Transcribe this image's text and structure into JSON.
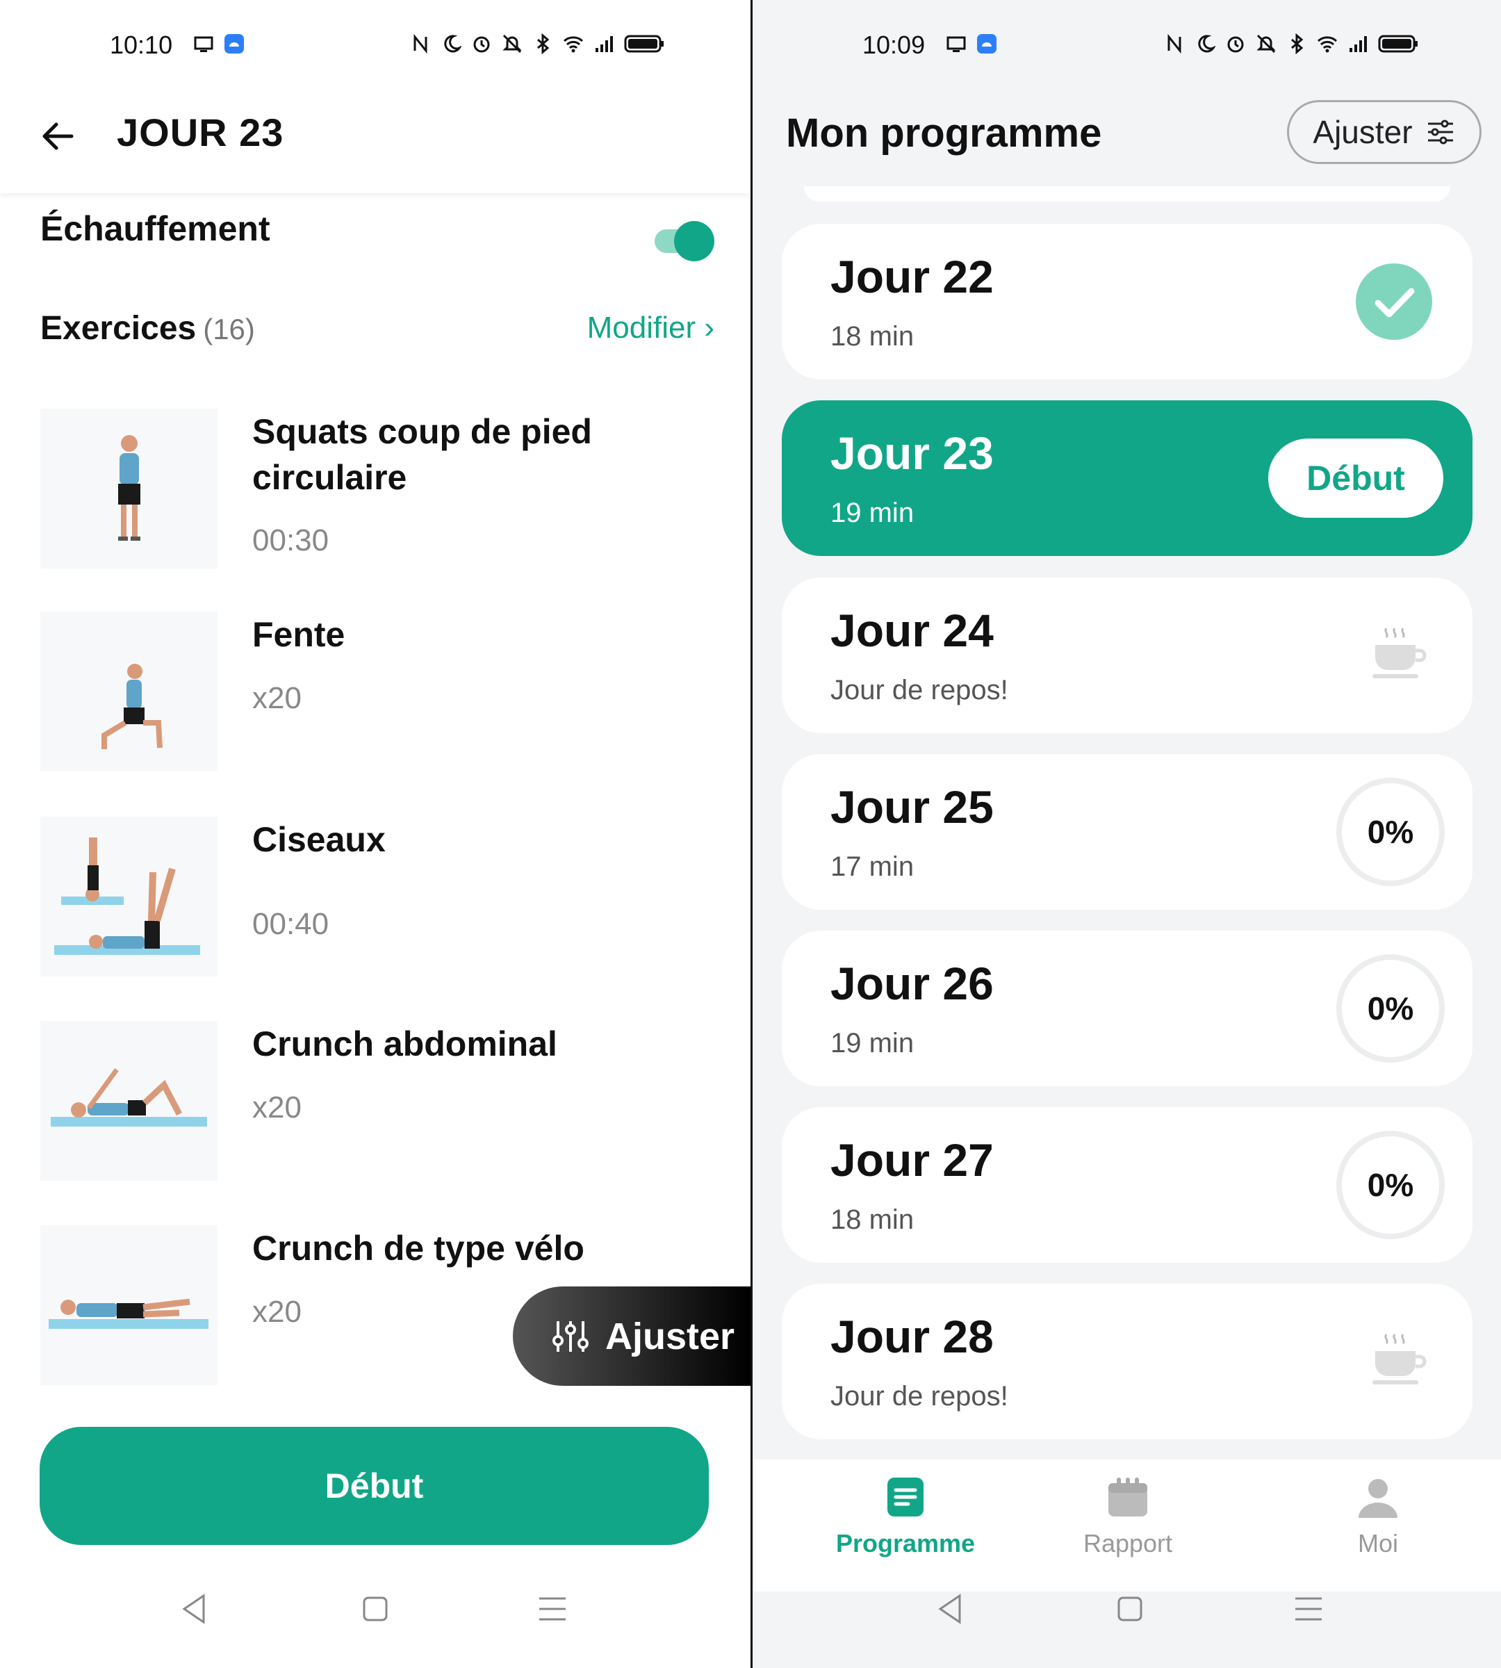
{
  "left": {
    "status": {
      "time": "10:10"
    },
    "title": "JOUR 23",
    "warmup": {
      "label": "Échauffement",
      "enabled": true
    },
    "exercises": {
      "label": "Exercices",
      "count": "(16)",
      "edit": "Modifier",
      "items": [
        {
          "name": "Squats coup de pied circulaire",
          "value": "00:30"
        },
        {
          "name": "Fente",
          "value": "x20"
        },
        {
          "name": "Ciseaux",
          "value": "00:40"
        },
        {
          "name": "Crunch abdominal",
          "value": "x20"
        },
        {
          "name": "Crunch de type vélo",
          "value": "x20"
        }
      ]
    },
    "fab_label": "Ajuster",
    "start_label": "Début"
  },
  "right": {
    "status": {
      "time": "10:09"
    },
    "title": "Mon programme",
    "adjust_label": "Ajuster",
    "days": [
      {
        "name": "Jour 22",
        "sub": "18 min",
        "state": "done"
      },
      {
        "name": "Jour 23",
        "sub": "19 min",
        "state": "current",
        "action": "Début"
      },
      {
        "name": "Jour 24",
        "sub": "Jour de repos!",
        "state": "rest"
      },
      {
        "name": "Jour 25",
        "sub": "17 min",
        "state": "pending",
        "progress": "0%"
      },
      {
        "name": "Jour 26",
        "sub": "19 min",
        "state": "pending",
        "progress": "0%"
      },
      {
        "name": "Jour 27",
        "sub": "18 min",
        "state": "pending",
        "progress": "0%"
      },
      {
        "name": "Jour 28",
        "sub": "Jour de repos!",
        "state": "rest"
      }
    ],
    "tabs": [
      {
        "label": "Programme",
        "icon": "programme-icon",
        "active": true
      },
      {
        "label": "Rapport",
        "icon": "calendar-icon",
        "active": false
      },
      {
        "label": "Moi",
        "icon": "person-icon",
        "active": false
      }
    ]
  },
  "colors": {
    "accent": "#11a688",
    "accent_light": "#7fd6bd",
    "background": "#f3f4f6"
  }
}
